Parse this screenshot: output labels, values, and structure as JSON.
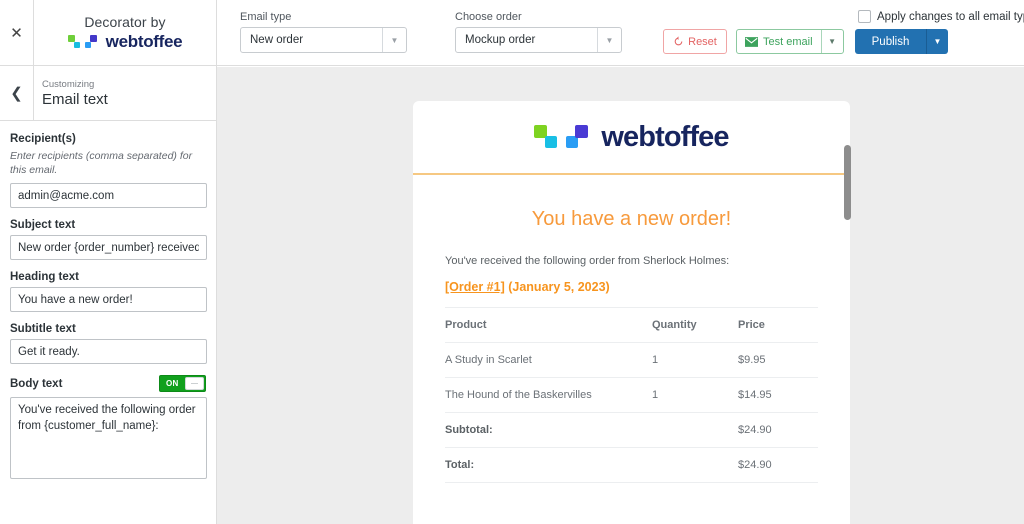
{
  "sidebar": {
    "close_icon": "close-icon",
    "brand_top": "Decorator by",
    "brand_name": "webtoffee",
    "back_icon": "chevron-left-icon",
    "customizing_label": "Customizing",
    "panel_title": "Email text",
    "fields": {
      "recipients": {
        "label": "Recipient(s)",
        "help": "Enter recipients (comma separated) for this email.",
        "value": "admin@acme.com"
      },
      "subject": {
        "label": "Subject text",
        "value": "New order {order_number} received!"
      },
      "heading": {
        "label": "Heading text",
        "value": "You have a new order!"
      },
      "subtitle": {
        "label": "Subtitle text",
        "value": "Get it ready."
      },
      "body": {
        "label": "Body text",
        "toggle_state": "ON",
        "value": "You've received the following order from {customer_full_name}:"
      }
    }
  },
  "topbar": {
    "email_type": {
      "label": "Email type",
      "value": "New order"
    },
    "choose_order": {
      "label": "Choose order",
      "value": "Mockup order"
    },
    "reset_label": "Reset",
    "test_email_label": "Test email",
    "publish_label": "Publish",
    "apply_all_label": "Apply changes to all email type",
    "accent_blue": "#2271b1",
    "reset_red": "#e36363",
    "test_green": "#3da35d"
  },
  "preview": {
    "logo_word": "webtoffee",
    "heading": "You have a new order!",
    "intro": "You've received the following order from Sherlock Holmes:",
    "order_link": "[Order #1]",
    "order_date": "(January 5, 2023)",
    "accent_orange": "#f7941e",
    "table": {
      "headers": [
        "Product",
        "Quantity",
        "Price"
      ],
      "rows": [
        {
          "product": "A Study in Scarlet",
          "quantity": "1",
          "price": "$9.95"
        },
        {
          "product": "The Hound of the Baskervilles",
          "quantity": "1",
          "price": "$14.95"
        }
      ],
      "summary": [
        {
          "label": "Subtotal:",
          "value": "$24.90"
        },
        {
          "label": "Total:",
          "value": "$24.90"
        }
      ]
    }
  }
}
